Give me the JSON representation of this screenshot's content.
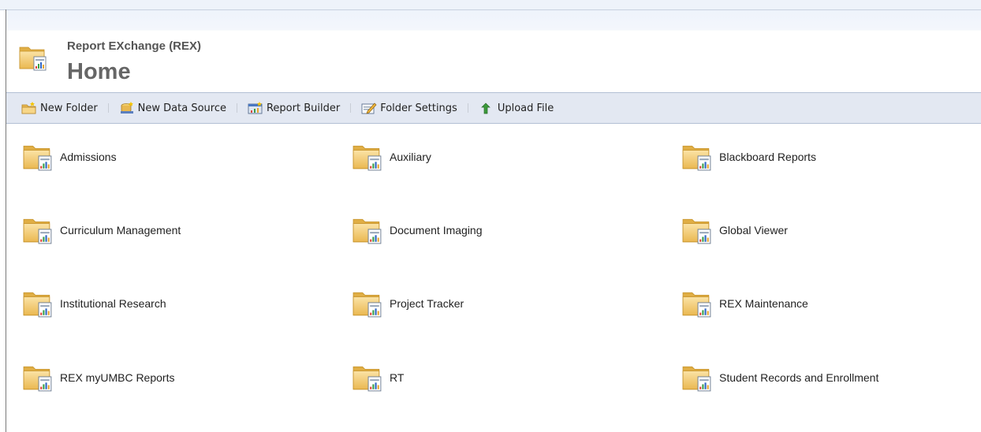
{
  "header": {
    "subtitle": "Report EXchange (REX)",
    "title": "Home"
  },
  "toolbar": {
    "items": [
      {
        "label": "New Folder",
        "icon": "new-folder-icon"
      },
      {
        "label": "New Data Source",
        "icon": "new-data-source-icon"
      },
      {
        "label": "Report Builder",
        "icon": "report-builder-icon"
      },
      {
        "label": "Folder Settings",
        "icon": "folder-settings-icon"
      },
      {
        "label": "Upload File",
        "icon": "upload-arrow-icon"
      }
    ]
  },
  "folders": [
    {
      "label": "Admissions"
    },
    {
      "label": "Auxiliary"
    },
    {
      "label": "Blackboard Reports"
    },
    {
      "label": "Curriculum Management"
    },
    {
      "label": "Document Imaging"
    },
    {
      "label": "Global Viewer"
    },
    {
      "label": "Institutional Research"
    },
    {
      "label": "Project Tracker"
    },
    {
      "label": "REX Maintenance"
    },
    {
      "label": "REX myUMBC Reports"
    },
    {
      "label": "RT"
    },
    {
      "label": "Student Records and Enrollment"
    }
  ],
  "colors": {
    "folder": "#f2c866",
    "toolbar_bg": "#e3e8f2",
    "title_text": "#666666"
  }
}
